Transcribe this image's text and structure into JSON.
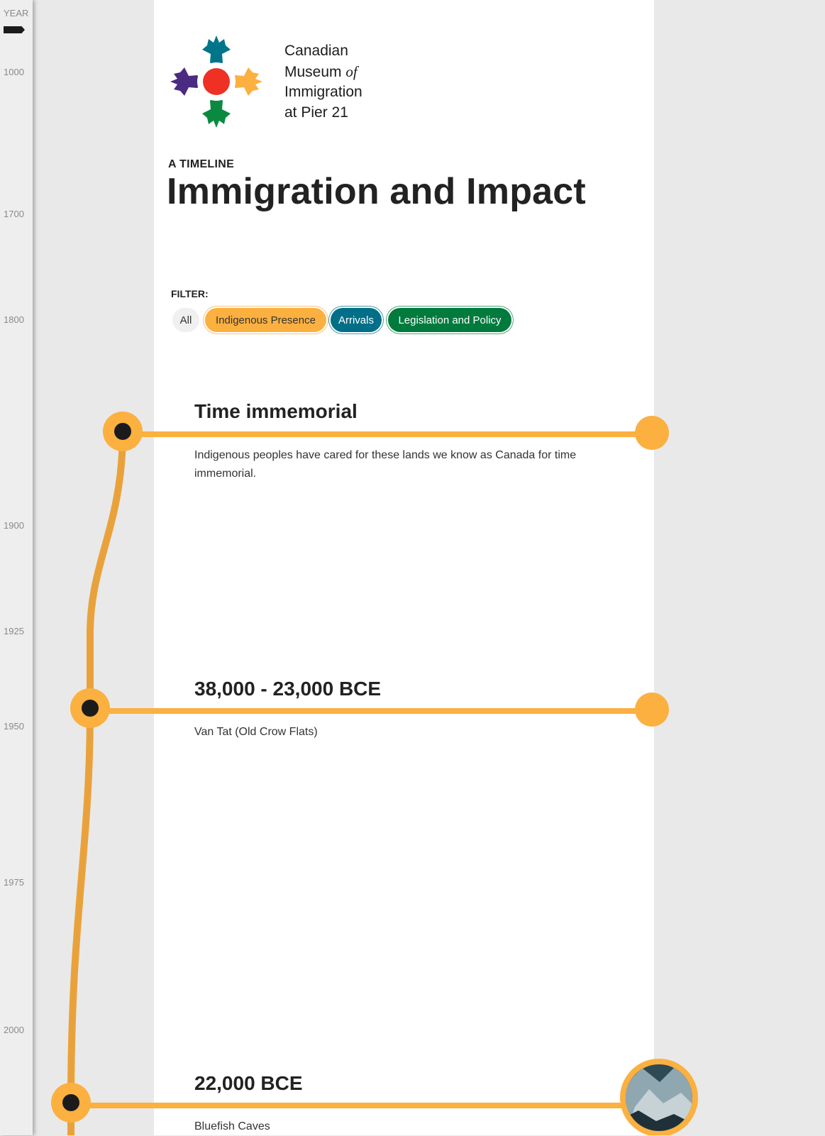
{
  "year_rail": {
    "header": "YEAR",
    "labels": [
      "1000",
      "1700",
      "1800",
      "1900",
      "1925",
      "1950",
      "1975",
      "2000"
    ]
  },
  "logo": {
    "line1": "Canadian",
    "line2_prefix": "Museum ",
    "line2_em": "of",
    "line3": "Immigration",
    "line4": "at Pier 21",
    "colors": {
      "teal": "#00758a",
      "orange": "#fbb040",
      "purple": "#4b2a82",
      "green": "#0a8a40",
      "red": "#ee3124"
    }
  },
  "header": {
    "kicker": "A TIMELINE",
    "title": "Immigration and Impact"
  },
  "filter": {
    "label": "FILTER:",
    "options": [
      "All",
      "Indigenous Presence",
      "Arrivals",
      "Legislation and Policy"
    ]
  },
  "events": [
    {
      "title": "Time immemorial",
      "description": "Indigenous peoples have cared for these lands we know as Canada for time immemorial."
    },
    {
      "title": "38,000 - 23,000 BCE",
      "description": "Van Tat (Old Crow Flats)"
    },
    {
      "title": "22,000 BCE",
      "description": "Bluefish Caves"
    }
  ],
  "colors": {
    "accent_orange": "#fbb040",
    "arrivals_teal": "#006f87",
    "legislation_green": "#007a3d",
    "node_dark": "#1b1b1b"
  }
}
